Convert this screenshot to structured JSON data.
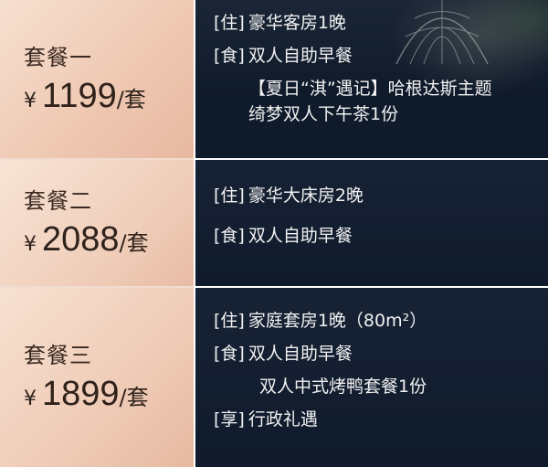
{
  "packages": [
    {
      "name": "套餐一",
      "currency": "¥",
      "price": "1199",
      "unit": "/套",
      "items": [
        {
          "tag": "[住]",
          "text": "豪华客房1晚"
        },
        {
          "tag": "[食]",
          "text": "双人自助早餐"
        }
      ],
      "note_line1": "【夏日“淇”遇记】哈根达斯主题",
      "note_line2": "绮梦双人下午茶1份"
    },
    {
      "name": "套餐二",
      "currency": "¥",
      "price": "2088",
      "unit": "/套",
      "items": [
        {
          "tag": "[住]",
          "text": "豪华大床房2晚"
        },
        {
          "tag": "[食]",
          "text": "双人自助早餐"
        }
      ]
    },
    {
      "name": "套餐三",
      "currency": "¥",
      "price": "1899",
      "unit": "/套",
      "items": [
        {
          "tag": "[住]",
          "text": "家庭套房1晚（80m²）"
        },
        {
          "tag": "[食]",
          "text": "双人自助早餐"
        },
        {
          "tag": "",
          "text": "双人中式烤鸭套餐1份"
        },
        {
          "tag": "[享]",
          "text": "行政礼遇"
        }
      ]
    }
  ],
  "colors": {
    "left_panel": "#efc9b3",
    "right_panel": "#0f1a2b",
    "text_light": "#f1f1f1",
    "text_dark": "#3a2a21"
  }
}
